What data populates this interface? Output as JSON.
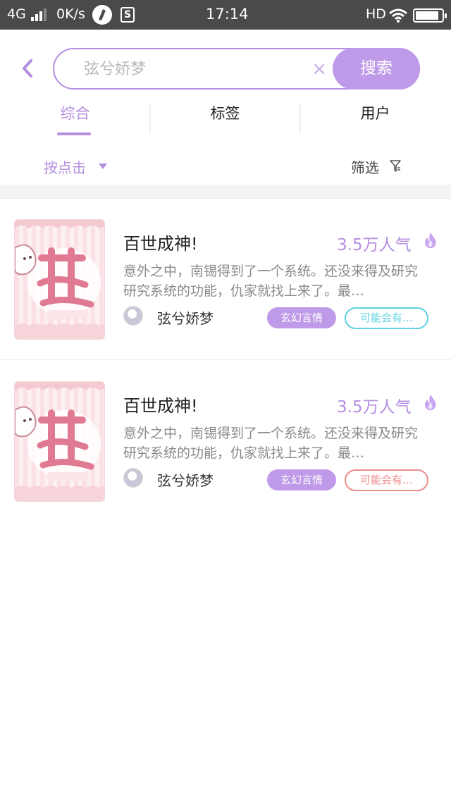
{
  "status_bar": {
    "network": "4G",
    "speed": "0K/s",
    "app_badge": "S",
    "time": "17:14",
    "hd": "HD",
    "battery_level": 0.9
  },
  "search": {
    "placeholder": "弦兮娇梦",
    "clear_glyph": "×",
    "button_label": "搜索"
  },
  "tabs": [
    {
      "label": "综合",
      "active": true
    },
    {
      "label": "标签",
      "active": false
    },
    {
      "label": "用户",
      "active": false
    }
  ],
  "filters": {
    "sort_label": "按点击",
    "filter_label": "筛选"
  },
  "results": [
    {
      "title": "百世成神!",
      "popularity": "3.5万人气",
      "description": "意外之中，南锡得到了一个系统。还没来得及研究研究系统的功能，仇家就找上来了。最…",
      "author": "弦兮娇梦",
      "genre_tag": "玄幻言情",
      "extra_tag": "可能会有…",
      "extra_tag_color": "#5dd2e0"
    },
    {
      "title": "百世成神!",
      "popularity": "3.5万人气",
      "description": "意外之中，南锡得到了一个系统。还没来得及研究研究系统的功能，仇家就找上来了。最…",
      "author": "弦兮娇梦",
      "genre_tag": "玄幻言情",
      "extra_tag": "可能会有…",
      "extra_tag_color": "#ef8b8b"
    }
  ],
  "colors": {
    "accent": "#b48ee0",
    "button": "#bf9ae8"
  }
}
